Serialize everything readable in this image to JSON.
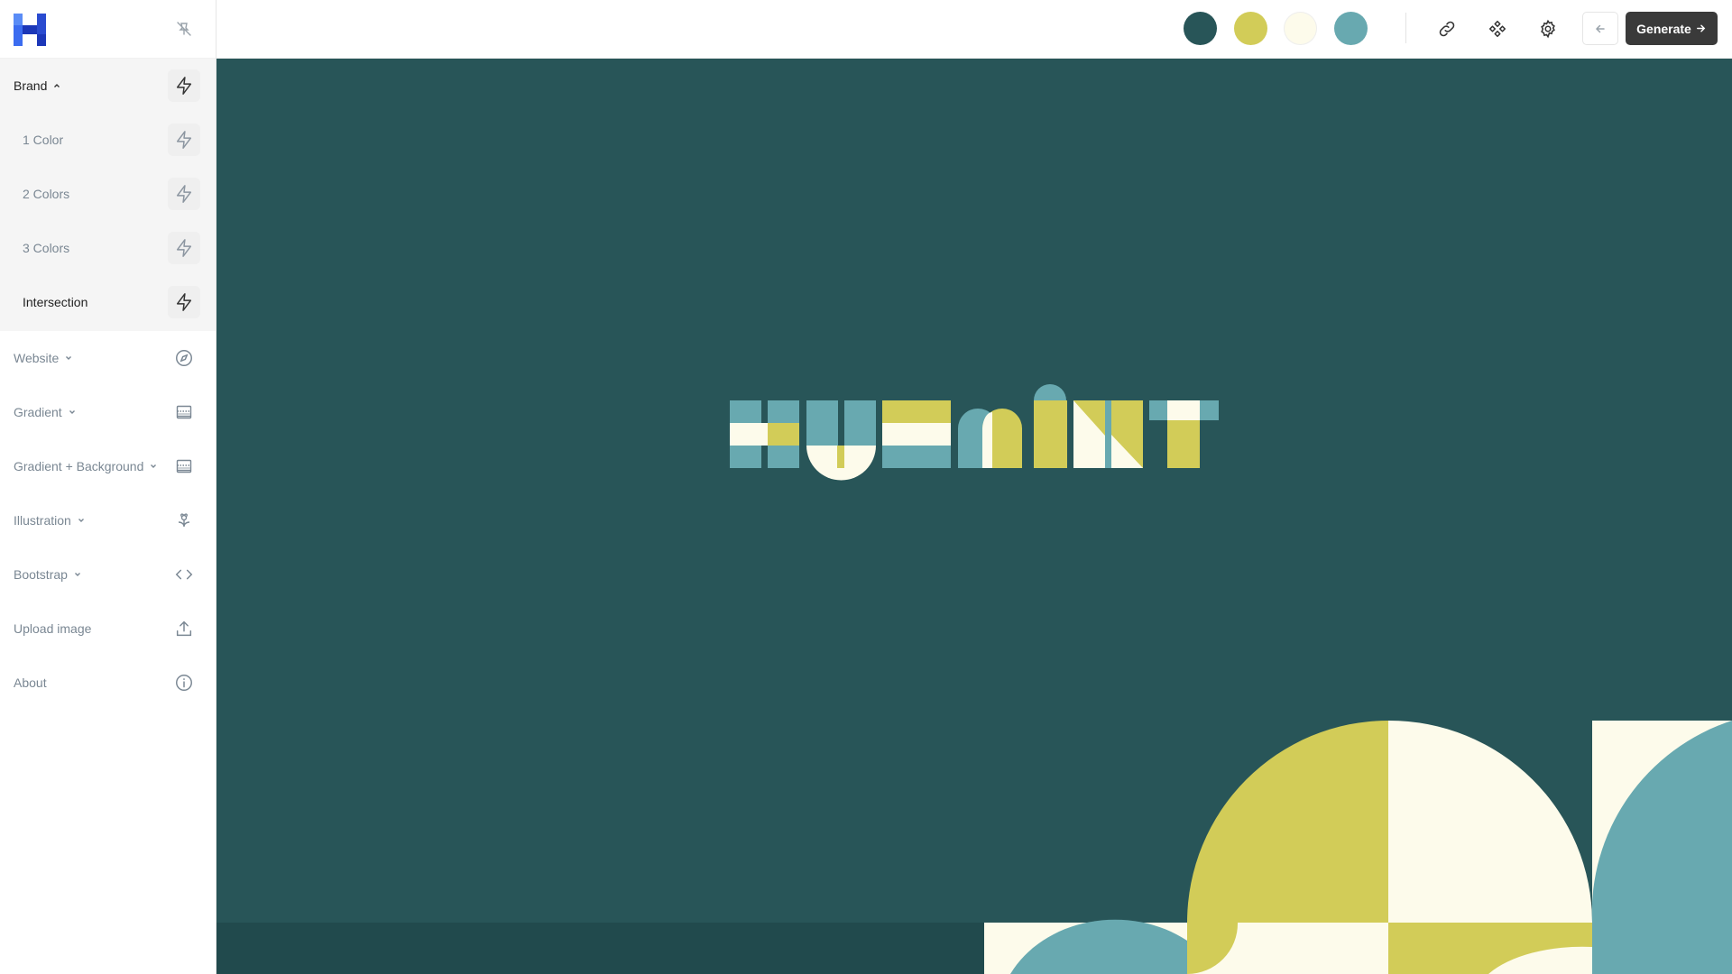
{
  "app": {
    "logo_name": "huemint-logo"
  },
  "colors": {
    "primary": "#285558",
    "yellow": "#d2cc58",
    "cream": "#fdfbeb",
    "teal": "#68a9b0",
    "button_dark": "#3a3a3a"
  },
  "sidebar": {
    "brand": {
      "label": "Brand",
      "icon": "lightning-icon"
    },
    "brand_sub": [
      {
        "label": "1 Color",
        "icon": "lightning-icon"
      },
      {
        "label": "2 Colors",
        "icon": "lightning-icon"
      },
      {
        "label": "3 Colors",
        "icon": "lightning-icon"
      },
      {
        "label": "Intersection",
        "icon": "lightning-icon",
        "active": true
      }
    ],
    "items": [
      {
        "label": "Website",
        "icon": "compass-icon",
        "has_caret": true
      },
      {
        "label": "Gradient",
        "icon": "gradient-icon",
        "has_caret": true
      },
      {
        "label": "Gradient + Background",
        "icon": "gradient-icon",
        "has_caret": true
      },
      {
        "label": "Illustration",
        "icon": "flower-icon",
        "has_caret": true
      },
      {
        "label": "Bootstrap",
        "icon": "code-icon",
        "has_caret": true
      },
      {
        "label": "Upload image",
        "icon": "upload-icon",
        "has_caret": false
      },
      {
        "label": "About",
        "icon": "info-icon",
        "has_caret": false
      }
    ]
  },
  "toolbar": {
    "swatches": [
      "#285558",
      "#d2cc58",
      "#fdfbeb",
      "#68a9b0"
    ],
    "icons": [
      "link-icon",
      "figma-icon",
      "settings-gear-icon"
    ],
    "back_icon": "arrow-left-icon",
    "generate_label": "Generate"
  }
}
